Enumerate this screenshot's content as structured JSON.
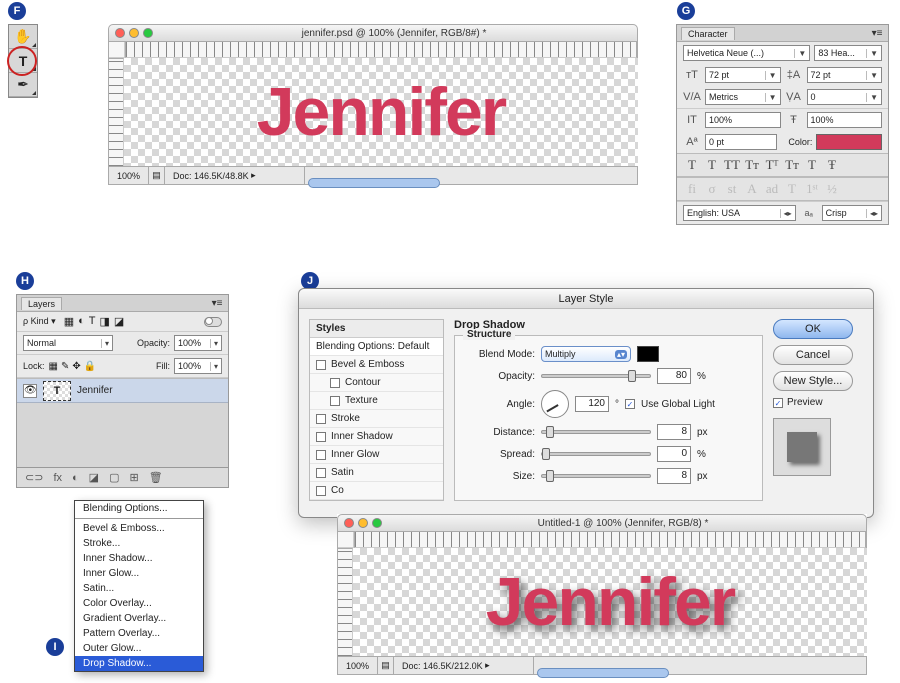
{
  "badges": {
    "F": "F",
    "G": "G",
    "H": "H",
    "I": "I",
    "J": "J"
  },
  "tools": {
    "hand": "✋",
    "type": "T",
    "path": "✒"
  },
  "docF": {
    "title": "jennifer.psd @ 100% (Jennifer, RGB/8#) *",
    "text": "Jennifer",
    "zoom": "100%",
    "docinfo": "Doc: 146.5K/48.8K"
  },
  "character": {
    "tab": "Character",
    "font": "Helvetica Neue (...)",
    "weight": "83 Hea...",
    "size": "72 pt",
    "leading": "72 pt",
    "kerning": "Metrics",
    "tracking": "0",
    "vscale": "100%",
    "hscale": "100%",
    "baseline": "0 pt",
    "colorLabel": "Color:",
    "color": "#d23a5b",
    "typestyles": [
      "T",
      "T",
      "TT",
      "Tᴛ",
      "Tᵀ",
      "Tᴛ",
      "T",
      "Ŧ"
    ],
    "opentype": [
      "fi",
      "σ",
      "st",
      "A",
      "ad",
      "T",
      "1ˢᵗ",
      "½"
    ],
    "lang": "English: USA",
    "aa_label": "aₐ",
    "aa": "Crisp"
  },
  "layers": {
    "tab": "Layers",
    "kindLabel": "Kind",
    "kind": "ρ",
    "filters": [
      "▦",
      "◐",
      "T",
      "◨",
      "◪"
    ],
    "blend": "Normal",
    "opacityLabel": "Opacity:",
    "opacity": "100%",
    "lockLabel": "Lock:",
    "lockicons": [
      "▦",
      "✎",
      "✥",
      "🔒"
    ],
    "fillLabel": "Fill:",
    "fill": "100%",
    "layer1": "Jennifer",
    "footicons": [
      "⊂⊃",
      "fx",
      "◐",
      "◪",
      "▢",
      "⊞",
      "🗑"
    ]
  },
  "fxmenu": {
    "items": [
      "Blending Options...",
      "Bevel & Emboss...",
      "Stroke...",
      "Inner Shadow...",
      "Inner Glow...",
      "Satin...",
      "Color Overlay...",
      "Gradient Overlay...",
      "Pattern Overlay...",
      "Outer Glow...",
      "Drop Shadow..."
    ]
  },
  "layerstyle": {
    "title": "Layer Style",
    "stylesHdr": "Styles",
    "blendDefault": "Blending Options: Default",
    "list": [
      "Bevel & Emboss",
      "Contour",
      "Texture",
      "Stroke",
      "Inner Shadow",
      "Inner Glow",
      "Satin",
      "Co"
    ],
    "sectionTitle": "Drop Shadow",
    "structure": "Structure",
    "blendModeLbl": "Blend Mode:",
    "blendMode": "Multiply",
    "opacityLbl": "Opacity:",
    "opacity": "80",
    "pct": "%",
    "angleLbl": "Angle:",
    "angle": "120",
    "deg": "°",
    "globalLight": "Use Global Light",
    "distanceLbl": "Distance:",
    "distance": "8",
    "px": "px",
    "spreadLbl": "Spread:",
    "spread": "0",
    "sizeLbl": "Size:",
    "size": "8",
    "ok": "OK",
    "cancel": "Cancel",
    "newstyle": "New Style...",
    "preview": "Preview",
    "swatch": "#000"
  },
  "docJ": {
    "title": "Untitled-1 @ 100% (Jennifer, RGB/8) *",
    "text": "Jennifer",
    "zoom": "100%",
    "docinfo": "Doc: 146.5K/212.0K"
  }
}
